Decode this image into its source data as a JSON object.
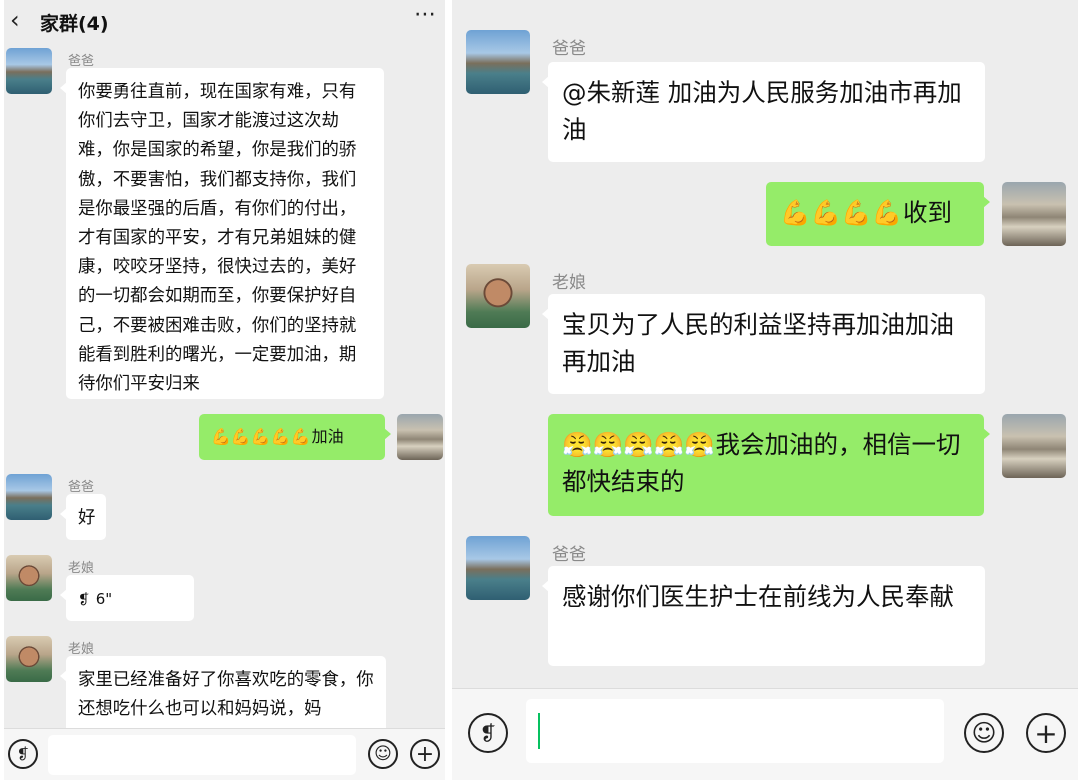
{
  "left": {
    "header": {
      "back_icon": "back-icon",
      "title": "家群(4)",
      "more_icon": "more-icon"
    },
    "messages": {
      "m1": {
        "sender": "爸爸",
        "text": "你要勇往直前，现在国家有难，只有你们去守卫，国家才能渡过这次劫难，你是国家的希望，你是我们的骄傲，不要害怕，我们都支持你，我们是你最坚强的后盾，有你们的付出，才有国家的平安，才有兄弟姐妹的健康，咬咬牙坚持，很快过去的，美好的一切都会如期而至，你要保护好自己，不要被困难击败，你们的坚持就能看到胜利的曙光，一定要加油，期待你们平安归来"
      },
      "m2": {
        "emoji": "💪💪💪💪💪",
        "text": "加油"
      },
      "m3": {
        "sender": "爸爸",
        "text": "好"
      },
      "m4": {
        "sender": "老娘",
        "voice_icon": "voice-icon",
        "duration": "6\""
      },
      "m5": {
        "sender": "老娘",
        "text": "家里已经准备好了你喜欢吃的零食，你还想吃什么也可以和妈妈说，妈"
      }
    },
    "input_bar": {
      "voice_icon": "voice-input-icon",
      "emoji_icon": "emoji-icon",
      "plus_icon": "plus-icon"
    }
  },
  "right": {
    "messages": {
      "m1": {
        "sender": "爸爸",
        "text": "@朱新莲  加油为人民服务加油市再加油"
      },
      "m2": {
        "emoji": "💪💪💪💪",
        "text": "收到"
      },
      "m3": {
        "sender": "老娘",
        "text": "宝贝为了人民的利益坚持再加油加油再加油"
      },
      "m4": {
        "emoji": "😤😤😤😤😤",
        "text": "我会加油的，相信一切都快结束的"
      },
      "m5": {
        "sender": "爸爸",
        "text": "感谢你们医生护士在前线为人民奉献"
      }
    },
    "input_bar": {
      "voice_icon": "voice-input-icon",
      "emoji_icon": "emoji-icon",
      "plus_icon": "plus-icon"
    }
  },
  "colors": {
    "chat_bg": "#ededed",
    "self_bubble": "#95ec69",
    "other_bubble": "#ffffff",
    "caret": "#07c160"
  }
}
